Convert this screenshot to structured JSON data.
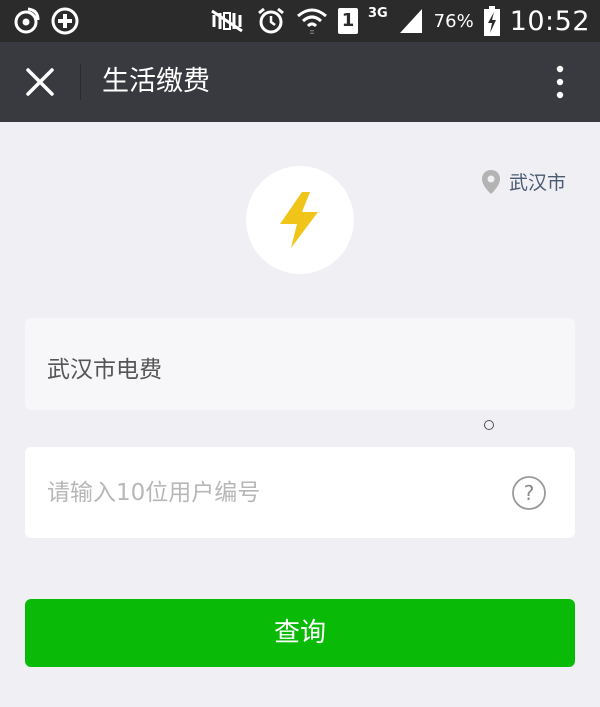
{
  "status_bar": {
    "sim_slot": "1",
    "network": "3G",
    "battery": "76%",
    "time": "10:52",
    "icons": [
      "weibo-icon",
      "add-circle-icon",
      "mute-icon",
      "alarm-icon",
      "wifi-icon",
      "sim-icon",
      "signal-icon",
      "battery-icon"
    ]
  },
  "title_bar": {
    "title": "生活缴费",
    "close_icon": "close-icon",
    "more_icon": "more-vertical-icon"
  },
  "location": {
    "city": "武汉市",
    "icon": "location-pin-icon"
  },
  "service": {
    "icon": "lightning-icon",
    "icon_color": "#f0c419"
  },
  "form": {
    "company": "武汉市电费",
    "account_placeholder": "请输入10位用户编号",
    "account_value": "",
    "help_icon": "help-icon"
  },
  "query_button": {
    "label": "查询",
    "color": "#09bb07"
  }
}
